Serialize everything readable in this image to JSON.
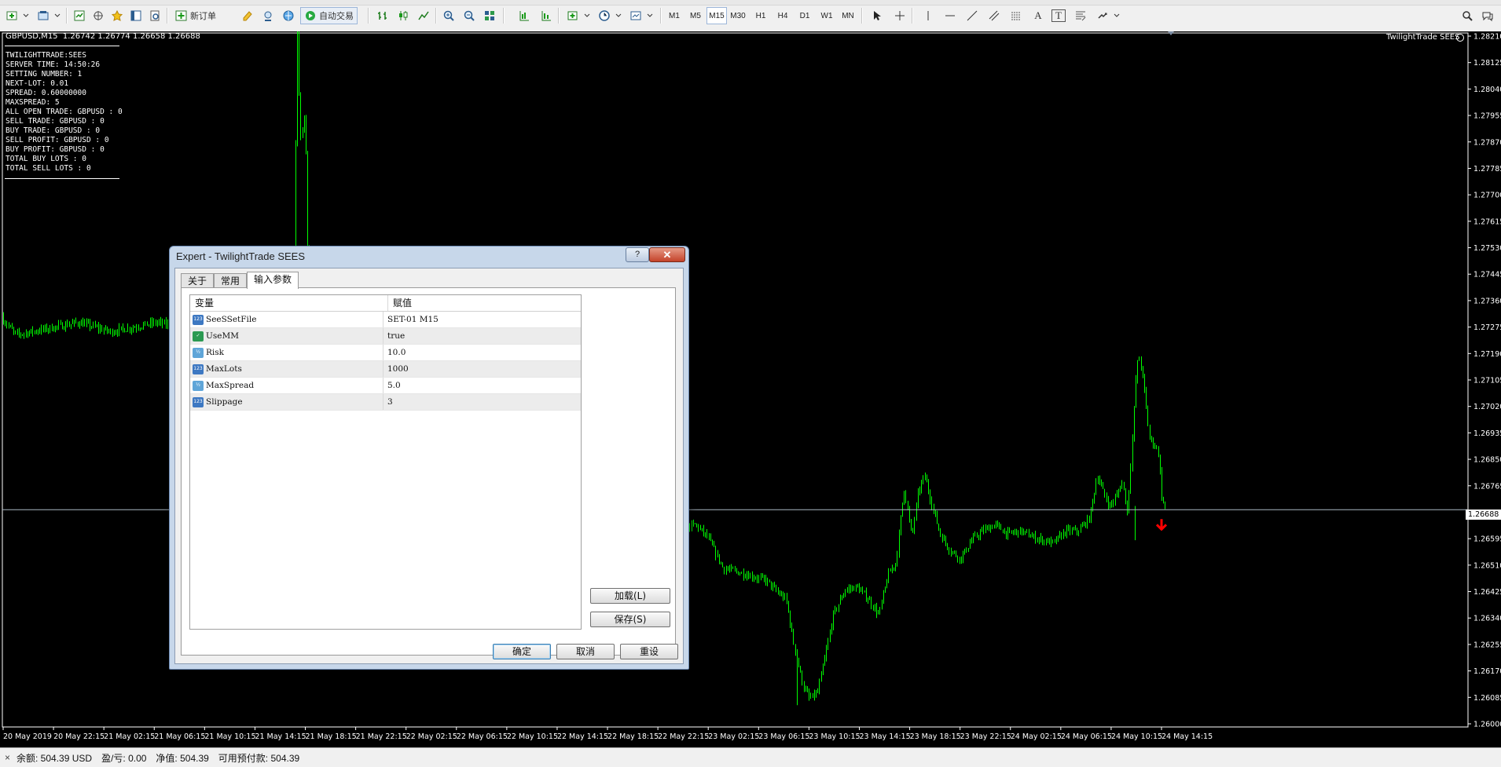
{
  "toolbar": {
    "new_order": "新订单",
    "auto_trading": "自动交易",
    "timeframes": [
      "M1",
      "M5",
      "M15",
      "M30",
      "H1",
      "H4",
      "D1",
      "W1",
      "MN"
    ],
    "active_timeframe": "M15",
    "drawing_text_tool": "A",
    "drawing_label_tool": "T"
  },
  "chart": {
    "symbol_line": "GBPUSD,M15  1.26742 1.26774 1.26658 1.26688",
    "ea_label": "TwilightTrade SEES",
    "current_price": "1.26688",
    "price_ticks": [
      "1.28210",
      "1.28125",
      "1.28040",
      "1.27955",
      "1.27870",
      "1.27785",
      "1.27700",
      "1.27615",
      "1.27530",
      "1.27445",
      "1.27360",
      "1.27275",
      "1.27190",
      "1.27105",
      "1.27020",
      "1.26935",
      "1.26850",
      "1.26765",
      "1.26680",
      "1.26595",
      "1.26510",
      "1.26425",
      "1.26340",
      "1.26255",
      "1.26170",
      "1.26085",
      "1.26000"
    ],
    "time_ticks": [
      "20 May 2019",
      "20 May 22:15",
      "21 May 02:15",
      "21 May 06:15",
      "21 May 10:15",
      "21 May 14:15",
      "21 May 18:15",
      "21 May 22:15",
      "22 May 02:15",
      "22 May 06:15",
      "22 May 10:15",
      "22 May 14:15",
      "22 May 18:15",
      "22 May 22:15",
      "23 May 02:15",
      "23 May 06:15",
      "23 May 10:15",
      "23 May 14:15",
      "23 May 18:15",
      "23 May 22:15",
      "24 May 02:15",
      "24 May 06:15",
      "24 May 10:15",
      "24 May 14:15"
    ],
    "info_lines": [
      "TWILIGHTTRADE:SEES",
      "SERVER TIME: 14:50:26",
      "SETTING NUMBER: 1",
      "NEXT-LOT: 0.01",
      "SPREAD: 0.60000000",
      "MAXSPREAD: 5",
      "ALL OPEN TRADE: GBPUSD : 0",
      "SELL TRADE: GBPUSD : 0",
      "BUY TRADE: GBPUSD : 0",
      "SELL PROFIT: GBPUSD : 0",
      "BUY PROFIT: GBPUSD : 0",
      "TOTAL BUY LOTS : 0",
      "TOTAL SELL LOTS : 0"
    ],
    "colors": {
      "background": "#000000",
      "candles": "#00ff00",
      "price_line": "#aab7c4",
      "sell_arrow": "#ff0000"
    }
  },
  "dialog": {
    "title": "Expert - TwilightTrade SEES",
    "help_label": "?",
    "close_label": "✕",
    "tabs": [
      "关于",
      "常用",
      "输入参数"
    ],
    "active_tab": "输入参数",
    "columns": {
      "variable": "变量",
      "value": "赋值"
    },
    "params": [
      {
        "name": "SeeSSetFile",
        "value": "SET-01  M15",
        "type": "int",
        "icon_text": "123"
      },
      {
        "name": "UseMM",
        "value": "true",
        "type": "bool",
        "icon_text": "✓"
      },
      {
        "name": "Risk",
        "value": "10.0",
        "type": "dbl",
        "icon_text": "½"
      },
      {
        "name": "MaxLots",
        "value": "1000",
        "type": "int",
        "icon_text": "123"
      },
      {
        "name": "MaxSpread",
        "value": "5.0",
        "type": "dbl",
        "icon_text": "½"
      },
      {
        "name": "Slippage",
        "value": "3",
        "type": "int",
        "icon_text": "123"
      }
    ],
    "load_label": "加载(L)",
    "save_label": "保存(S)",
    "ok_label": "确定",
    "cancel_label": "取消",
    "reset_label": "重设"
  },
  "status": {
    "balance": "余额: 504.39 USD",
    "profit": "盈/亏: 0.00",
    "equity": "净值: 504.39",
    "free_margin": "可用预付款: 504.39"
  }
}
